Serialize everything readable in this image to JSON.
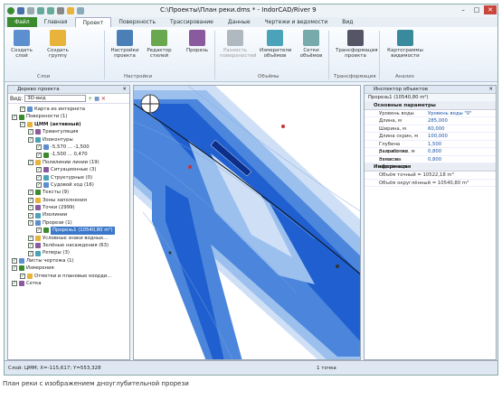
{
  "window": {
    "title": "C:\\Проекты\\План реки.dms * - IndorCAD/River 9"
  },
  "tabs": [
    "Файл",
    "Главная",
    "Проект",
    "Поверхность",
    "Трассирование",
    "Данные",
    "Чертежи и ведомости",
    "Вид"
  ],
  "ribbon": {
    "buttons": [
      {
        "label": "Создать слой",
        "icon": "layer-create-icon",
        "color": "#5b8fd0"
      },
      {
        "label": "Создать группу",
        "icon": "group-folder-icon",
        "color": "#e8b33a"
      },
      {
        "label": "Настройки проекта",
        "icon": "project-settings-icon",
        "color": "#4a7fb8"
      },
      {
        "label": "Редактор стилей",
        "icon": "style-editor-icon",
        "color": "#6aa84f"
      },
      {
        "label": "Прорезь",
        "icon": "cut-icon",
        "color": "#8a5a9e"
      },
      {
        "label": "Разность поверхностей",
        "icon": "surface-diff-icon",
        "color": "#b0b8c0"
      },
      {
        "label": "Измерители объёмов",
        "icon": "volume-meter-icon",
        "color": "#4aa3b9"
      },
      {
        "label": "Сетки объёмов",
        "icon": "volume-grid-icon",
        "color": "#7aa"
      },
      {
        "label": "Трансформация проекта",
        "icon": "transform-icon",
        "color": "#556"
      },
      {
        "label": "Картограммы видимости",
        "icon": "cartogram-icon",
        "color": "#3a8a9e"
      }
    ],
    "groups": [
      "Слои",
      "Настройки",
      "Объёмы",
      "Трансформация",
      "Анализ"
    ]
  },
  "left_panel": {
    "title": "Дерево проекта",
    "view_label": "Вид:",
    "view_value": "3D-вид",
    "items": [
      {
        "label": "Карта из интернета",
        "level": 1
      },
      {
        "label": "Поверхности (1)",
        "level": 0
      },
      {
        "label": "ЦММ (активный)",
        "level": 1,
        "bold": true
      },
      {
        "label": "Триангуляция",
        "level": 2
      },
      {
        "label": "Изоконтуры",
        "level": 2
      },
      {
        "label": "-5,570 ... -1,500",
        "level": 3
      },
      {
        "label": "-1,500 ... 0,470",
        "level": 3
      },
      {
        "label": "Полилинии линии (19)",
        "level": 2
      },
      {
        "label": "Ситуационные (3)",
        "level": 3
      },
      {
        "label": "Структурные (0)",
        "level": 3
      },
      {
        "label": "Судовой ход (16)",
        "level": 3
      },
      {
        "label": "Тексты (9)",
        "level": 2
      },
      {
        "label": "Зоны заполнения",
        "level": 2
      },
      {
        "label": "Точки (2999)",
        "level": 2
      },
      {
        "label": "Изолинии",
        "level": 2
      },
      {
        "label": "Прорези (1)",
        "level": 2
      },
      {
        "label": "Прорезь1 (10540,80 m²)",
        "level": 3,
        "selected": true
      },
      {
        "label": "Условные знаки водных...",
        "level": 2
      },
      {
        "label": "Зелёные насаждения (63)",
        "level": 2
      },
      {
        "label": "Реперы (3)",
        "level": 2
      },
      {
        "label": "Листы чертежа (1)",
        "level": 0
      },
      {
        "label": "Измерения",
        "level": 0
      },
      {
        "label": "Отметки и плановые коорди...",
        "level": 1
      },
      {
        "label": "Сетка",
        "level": 0
      }
    ]
  },
  "right_panel": {
    "title": "Инспектор объектов",
    "object": "Прорезь1 (10540,80 m²)",
    "section1": "Основные параметры",
    "params": [
      {
        "k": "Уровень воды",
        "v": "Уровень воды \"0\""
      },
      {
        "k": "Длина, м",
        "v": "285,000"
      },
      {
        "k": "Ширина, м",
        "v": "60,000"
      },
      {
        "k": "Длина скрин, м",
        "v": "100,000"
      },
      {
        "k": "Глубина разработки, м",
        "v": "1,500"
      },
      {
        "k": "Заложение откосов",
        "v": "0,800"
      },
      {
        "k": "Запас на неровность",
        "v": "0,800"
      }
    ],
    "section2": "Информация",
    "info": [
      {
        "k": "Объём точный = 10522,18 m³"
      },
      {
        "k": "Объём округлённый = 10540,80 m³"
      }
    ]
  },
  "status": {
    "left": "Слой: ЦММ; X=-115,617; Y=553,328",
    "mid": "1 точка"
  },
  "caption": "План реки с изображением дноуглубительной прорези",
  "colors": {
    "water_dark": "#1f5fcf",
    "water_mid": "#4b86dc",
    "water_light": "#9cc0ee",
    "water_pale": "#cfe0f6",
    "file_tab": "#3b8a2e"
  }
}
